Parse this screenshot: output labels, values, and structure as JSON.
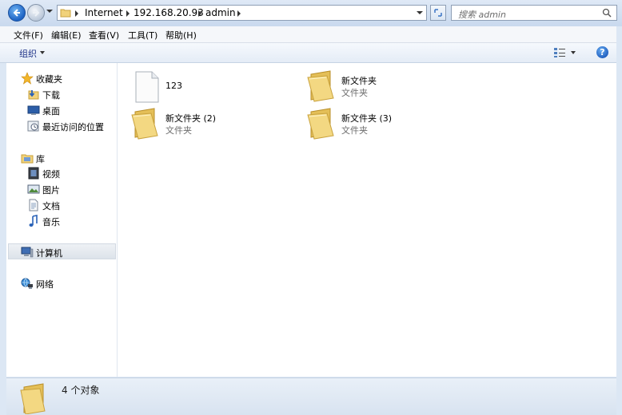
{
  "address": {
    "crumbs": [
      "Internet",
      "192.168.20.93",
      "admin"
    ]
  },
  "search": {
    "placeholder": "搜索 admin"
  },
  "menu": [
    "文件(F)",
    "编辑(E)",
    "查看(V)",
    "工具(T)",
    "帮助(H)"
  ],
  "toolbar": {
    "organize_label": "组织",
    "help_label": "?"
  },
  "nav": {
    "favorites": {
      "label": "收藏夹",
      "items": [
        "下载",
        "桌面",
        "最近访问的位置"
      ]
    },
    "libraries": {
      "label": "库",
      "items": [
        "视频",
        "图片",
        "文档",
        "音乐"
      ]
    },
    "computer": {
      "label": "计算机"
    },
    "network": {
      "label": "网络"
    }
  },
  "files": [
    {
      "name": "123",
      "type": "",
      "icon": "file-icon"
    },
    {
      "name": "新文件夹",
      "type": "文件夹",
      "icon": "folder-icon"
    },
    {
      "name": "新文件夹 (2)",
      "type": "文件夹",
      "icon": "folder-icon"
    },
    {
      "name": "新文件夹 (3)",
      "type": "文件夹",
      "icon": "folder-icon"
    }
  ],
  "status": {
    "text": "4 个对象"
  },
  "colors": {
    "accent": "#1d63c4",
    "folder": "#f1d27a",
    "selection": "#dde3ea"
  }
}
